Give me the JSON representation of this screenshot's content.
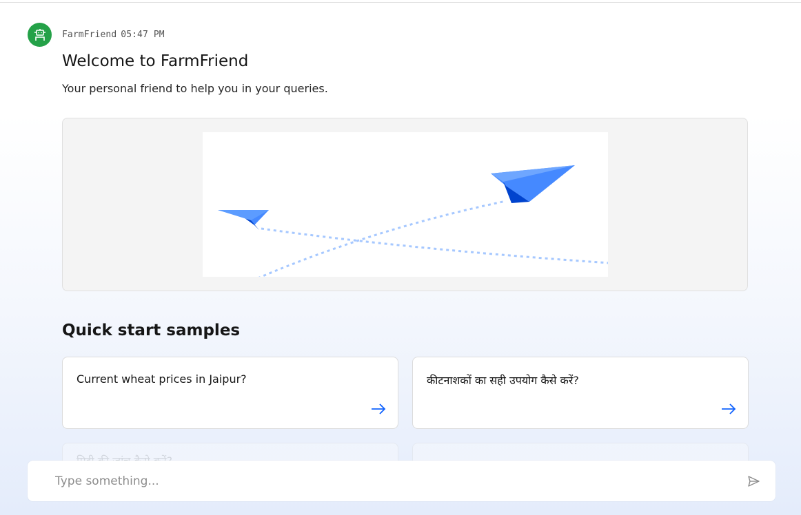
{
  "message": {
    "sender": "FarmFriend",
    "time": "05:47 PM",
    "title": "Welcome to FarmFriend",
    "subtitle": "Your personal friend to help you in your queries."
  },
  "quick_start": {
    "title": "Quick start samples",
    "samples": [
      {
        "label": "Current wheat prices in Jaipur?"
      },
      {
        "label": "कीटनाशकों का सही उपयोग कैसे करें?"
      },
      {
        "label": "मिट्टी की जांच कैसे करें?"
      },
      {
        "label": ""
      }
    ]
  },
  "input": {
    "placeholder": "Type something..."
  },
  "colors": {
    "avatar_bg": "#24a148",
    "accent": "#0f62fe",
    "plane_blue": "#4589ff",
    "plane_dark": "#0043ce",
    "dotted_path": "#a6c8ff"
  },
  "icons": {
    "avatar": "bot-icon",
    "card_arrow": "arrow-right-icon",
    "send": "send-icon"
  }
}
